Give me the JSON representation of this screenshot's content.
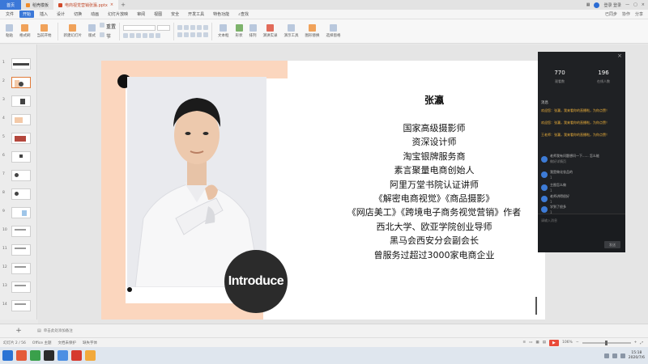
{
  "titlebar": {
    "home_tab": "首页",
    "template_tab": "稻壳模板",
    "file_tab": "电商视觉营销张瀛.pptx",
    "right_text": "登录 登录"
  },
  "menu": {
    "file": "文件",
    "items": [
      "开始",
      "插入",
      "设计",
      "切换",
      "动画",
      "幻灯片放映",
      "审阅",
      "视图",
      "安全",
      "开发工具",
      "特色功能",
      "查找"
    ],
    "right_items": [
      "已同步",
      "协作",
      "分享"
    ]
  },
  "ribbon": {
    "buttons": [
      "粘贴",
      "格式刷",
      "当前开始",
      "新建幻灯片",
      "版式",
      "重置",
      "节",
      "文本框",
      "形状",
      "排列",
      "演讲实录",
      "演示工具",
      "图形替换",
      "选择窗格"
    ]
  },
  "thumbs": {
    "numbers": [
      "1",
      "2",
      "3",
      "4",
      "5",
      "6",
      "7",
      "8",
      "9",
      "10",
      "11",
      "12",
      "13",
      "14",
      "15",
      "16"
    ]
  },
  "slide": {
    "intro_label": "Introduce",
    "name": "张瀛",
    "bio_lines": [
      "国家高级摄影师",
      "资深设计师",
      "淘宝银牌服务商",
      "素言聚量电商创始人",
      "阿里万堂书院认证讲师",
      "《解密电商视觉》《商品摄影》",
      "《网店美工》《跨境电子商务视觉营销》作者",
      "西北大学、欧亚学院创业导师",
      "黑马会西安分会副会长",
      "曾服务过超过3000家电商企业"
    ]
  },
  "live_panel": {
    "stat1_value": "770",
    "stat1_label": "观看数",
    "stat2_value": "196",
    "stat2_label": "在线人数",
    "messages_title": "消息",
    "system_messages": [
      "欢迎您：张瀛，我来看你的直播啦，为你点赞！",
      "欢迎您：张瀛，我来看你的直播啦，为你点赞！",
      "王老师：张瀛，我来看你的直播啦，为你点赞！"
    ],
    "chats": [
      {
        "title": "老师我有问题想问一下...... 怎么能",
        "sub": "做好详情页"
      },
      {
        "title": "我是做化妆品的",
        "sub": "1"
      },
      {
        "title": "主图怎么做",
        "sub": "1"
      },
      {
        "title": "老师讲得很好",
        "sub": "1"
      },
      {
        "title": "学到了很多",
        "sub": "1"
      }
    ],
    "input_placeholder": "请输入消息",
    "send_label": "发送"
  },
  "notes": {
    "placeholder": "单击此处添加备注"
  },
  "statusbar": {
    "slide_count": "幻灯片 2 / 56",
    "theme": "Office 主题",
    "protect": "文档未保护",
    "font_missing": "缺失字体",
    "zoom": "106%"
  },
  "taskbar": {
    "time": "15:18",
    "date": "2020/7/6"
  }
}
